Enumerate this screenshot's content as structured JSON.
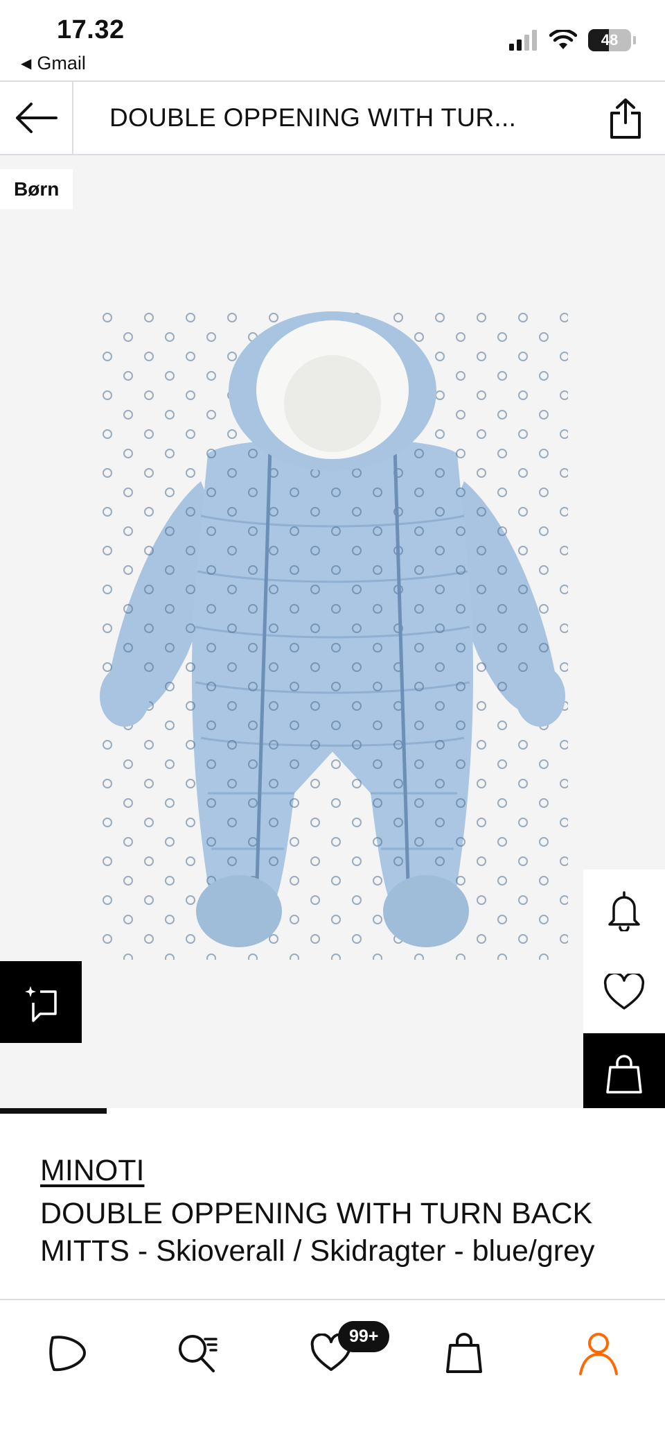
{
  "status_bar": {
    "time": "17.32",
    "back_app": "Gmail",
    "battery": "48"
  },
  "header": {
    "title": "DOUBLE OPPENING WITH TUR...",
    "icons": [
      "arrow-left-icon",
      "share-icon"
    ]
  },
  "gallery": {
    "badge": "Børn",
    "image_alt": "light blue padded baby snowsuit with white fleece hood",
    "progress_fraction": 0.16,
    "side_actions": [
      "bell-icon",
      "heart-icon",
      "shopping-bag-icon"
    ],
    "ai_button_icon": "sparkle-chat-icon"
  },
  "product": {
    "brand": "MINOTI",
    "name": "DOUBLE OPPENING WITH TURN BACK MITTS - Skioverall / Skidragter - blue/grey"
  },
  "bottom_nav": {
    "items": [
      "home-icon",
      "search-icon",
      "wishlist-icon",
      "bag-icon",
      "account-icon"
    ],
    "wishlist_count": "99+",
    "accent_color": "#ff6900"
  }
}
